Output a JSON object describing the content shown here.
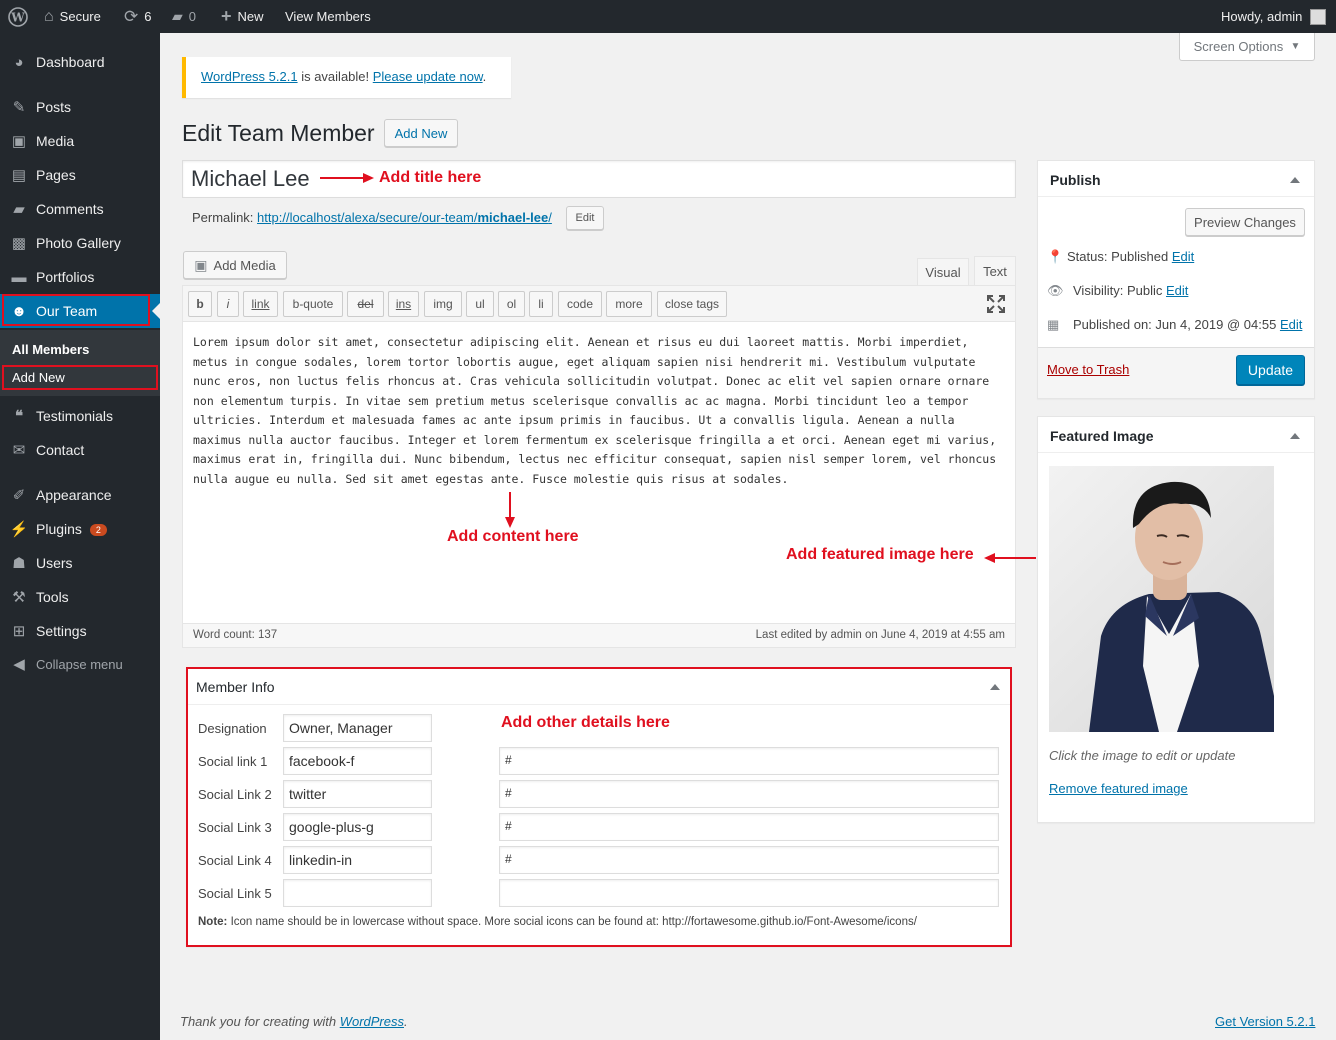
{
  "adminbar": {
    "site": "Secure",
    "updates": "6",
    "comments": "0",
    "new": "New",
    "view": "View Members",
    "howdy": "Howdy, admin"
  },
  "sidebar": {
    "items": [
      {
        "label": "Dashboard",
        "icon": "dashboard-icon"
      },
      {
        "label": "Posts",
        "icon": "pin-icon"
      },
      {
        "label": "Media",
        "icon": "media-icon"
      },
      {
        "label": "Pages",
        "icon": "page-icon"
      },
      {
        "label": "Comments",
        "icon": "comment-icon"
      },
      {
        "label": "Photo Gallery",
        "icon": "gallery-icon"
      },
      {
        "label": "Portfolios",
        "icon": "folder-icon"
      },
      {
        "label": "Our Team",
        "icon": "team-icon"
      },
      {
        "label": "Testimonials",
        "icon": "quote-icon"
      },
      {
        "label": "Contact",
        "icon": "mail-icon"
      },
      {
        "label": "Appearance",
        "icon": "brush-icon"
      },
      {
        "label": "Plugins",
        "icon": "plugin-icon",
        "badge": "2"
      },
      {
        "label": "Users",
        "icon": "user-icon"
      },
      {
        "label": "Tools",
        "icon": "wrench-icon"
      },
      {
        "label": "Settings",
        "icon": "settings-icon"
      },
      {
        "label": "Collapse menu",
        "icon": "collapse-icon"
      }
    ],
    "submenu": {
      "all": "All Members",
      "add": "Add New"
    }
  },
  "notice": {
    "link1": "WordPress 5.2.1",
    "text": " is available! ",
    "link2": "Please update now",
    "end": "."
  },
  "screen_options": "Screen Options",
  "page": {
    "title": "Edit Team Member",
    "add_new": "Add New",
    "post_title": "Michael Lee",
    "permalink_label": "Permalink:",
    "permalink_base": "http://localhost/alexa/secure/our-team/",
    "permalink_slug": "michael-lee",
    "permalink_end": "/",
    "edit": "Edit"
  },
  "editor": {
    "add_media": "Add Media",
    "tab_visual": "Visual",
    "tab_text": "Text",
    "buttons": [
      "b",
      "i",
      "link",
      "b-quote",
      "del",
      "ins",
      "img",
      "ul",
      "ol",
      "li",
      "code",
      "more",
      "close tags"
    ],
    "content": "Lorem ipsum dolor sit amet, consectetur adipiscing elit. Aenean et risus eu dui laoreet mattis. Morbi imperdiet, metus in congue sodales, lorem tortor lobortis augue, eget aliquam sapien nisi hendrerit mi. Vestibulum vulputate nunc eros, non luctus felis rhoncus at. Cras vehicula sollicitudin volutpat. Donec ac elit vel sapien ornare ornare non elementum turpis. In vitae sem pretium metus scelerisque convallis ac ac magna. Morbi tincidunt leo a tempor ultricies. Interdum et malesuada fames ac ante ipsum primis in faucibus. Ut a convallis ligula. Aenean a nulla maximus nulla auctor faucibus. Integer et lorem fermentum ex scelerisque fringilla a et orci. Aenean eget mi varius, maximus erat in, fringilla dui. Nunc bibendum, lectus nec efficitur consequat, sapien nisl semper lorem, vel rhoncus nulla augue eu nulla. Sed sit amet egestas ante. Fusce molestie quis risus at sodales.",
    "word_count": "Word count: 137",
    "last_edited": "Last edited by admin on June 4, 2019 at 4:55 am"
  },
  "annotations": {
    "title": "Add title here",
    "content": "Add content here",
    "featured": "Add featured image here",
    "details": "Add other details here"
  },
  "member_info": {
    "title": "Member Info",
    "rows": [
      {
        "label": "Designation",
        "value": "Owner, Manager",
        "link": null
      },
      {
        "label": "Social link 1",
        "value": "facebook-f",
        "link": "#"
      },
      {
        "label": "Social Link 2",
        "value": "twitter",
        "link": "#"
      },
      {
        "label": "Social Link 3",
        "value": "google-plus-g",
        "link": "#"
      },
      {
        "label": "Social Link 4",
        "value": "linkedin-in",
        "link": "#"
      },
      {
        "label": "Social Link 5",
        "value": "",
        "link": ""
      }
    ],
    "note_bold": "Note:",
    "note": " Icon name should be in lowercase without space. More social icons can be found at: http://fortawesome.github.io/Font-Awesome/icons/"
  },
  "publish": {
    "title": "Publish",
    "preview": "Preview Changes",
    "status_label": "Status: ",
    "status": "Published",
    "visibility_label": "Visibility: ",
    "visibility": "Public",
    "published_label": "Published on: ",
    "published": "Jun 4, 2019 @ 04:55",
    "edit": "Edit",
    "trash": "Move to Trash",
    "update": "Update"
  },
  "featured": {
    "title": "Featured Image",
    "hint": "Click the image to edit or update",
    "remove": "Remove featured image"
  },
  "footer": {
    "thanks": "Thank you for creating with ",
    "wp": "WordPress",
    "dot": ".",
    "version": "Get Version 5.2.1"
  },
  "colors": {
    "accent": "#0073aa",
    "annotation": "#e0101f",
    "sidebar": "#23282d"
  }
}
